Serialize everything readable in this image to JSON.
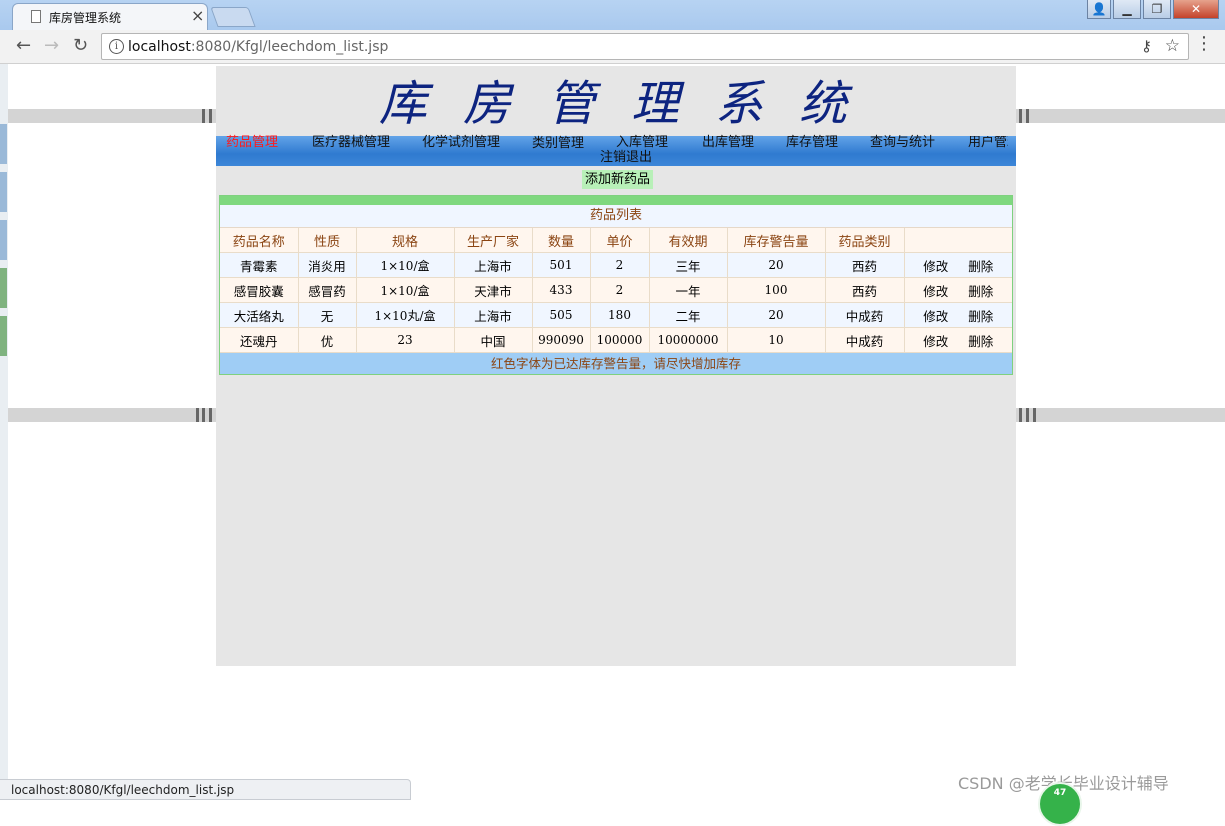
{
  "browser": {
    "tab_title": "库房管理系统",
    "tab_close": "×",
    "url_host": "localhost",
    "url_path": ":8080/Kfgl/leechdom_list.jsp",
    "status_url": "localhost:8080/Kfgl/leechdom_list.jsp",
    "icons": [
      "back-arrow-icon",
      "forward-arrow-icon",
      "reload-icon",
      "info-icon",
      "key-icon",
      "star-icon",
      "menu-dots-icon"
    ]
  },
  "header": {
    "title": "库房管理系统"
  },
  "nav": [
    {
      "label": "药品管理",
      "active": true
    },
    {
      "label": "医疗器械管理"
    },
    {
      "label": "化学试剂管理"
    },
    {
      "label": "类别管理"
    },
    {
      "label": "入库管理"
    },
    {
      "label": "出库管理"
    },
    {
      "label": "库存管理"
    },
    {
      "label": "查询与统计"
    },
    {
      "label": "用户管理"
    },
    {
      "label": "注销退出"
    }
  ],
  "add_button": "添加新药品",
  "list": {
    "caption": "药品列表",
    "columns": [
      "药品名称",
      "性质",
      "规格",
      "生产厂家",
      "数量",
      "单价",
      "有效期",
      "库存警告量",
      "药品类别",
      ""
    ],
    "rows": [
      [
        "青霉素",
        "消炎用",
        "1×10/盒",
        "上海市",
        "501",
        "2",
        "三年",
        "20",
        "西药"
      ],
      [
        "感冒胶囊",
        "感冒药",
        "1×10/盒",
        "天津市",
        "433",
        "2",
        "一年",
        "100",
        "西药"
      ],
      [
        "大活络丸",
        "无",
        "1×10丸/盒",
        "上海市",
        "505",
        "180",
        "二年",
        "20",
        "中成药"
      ],
      [
        "还魂丹",
        "优",
        "23",
        "中国",
        "990090",
        "100000",
        "10000000",
        "10",
        "中成药"
      ]
    ],
    "edit_label": "修改",
    "delete_label": "删除",
    "footer_note": "红色字体为已达库存警告量，请尽快增加库存"
  },
  "watermark": "CSDN @老学长毕业设计辅导",
  "badge": "47"
}
